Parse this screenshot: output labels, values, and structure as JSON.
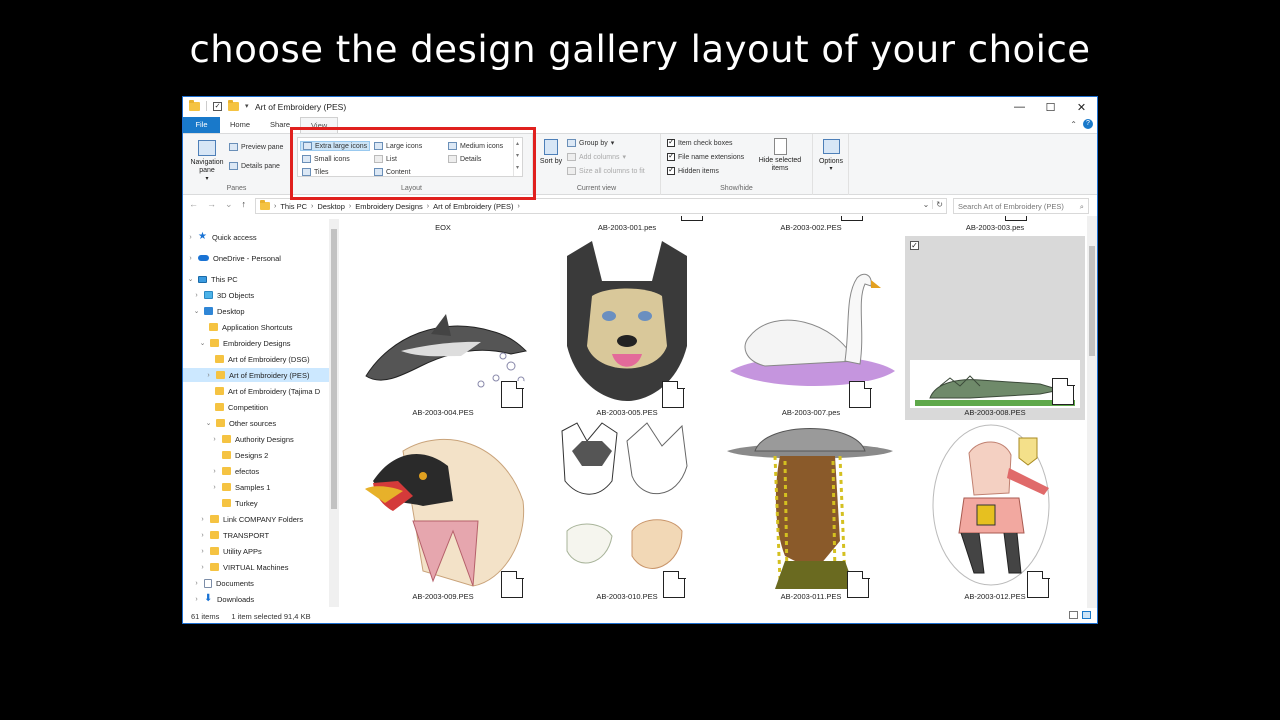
{
  "caption": "choose the design gallery layout of your choice",
  "window": {
    "title": "Art of Embroidery (PES)",
    "controls": {
      "minimize": "—",
      "maximize": "☐",
      "close": "✕"
    }
  },
  "ribbon": {
    "tabs": [
      "File",
      "Home",
      "Share",
      "View"
    ],
    "active_tab": "View",
    "collapse_glyph": "⌃",
    "help_glyph": "?",
    "panes": {
      "navigation_pane": "Navigation pane",
      "preview_pane": "Preview pane",
      "details_pane": "Details pane",
      "label": "Panes"
    },
    "layout": {
      "items": [
        "Extra large icons",
        "Large icons",
        "Medium icons",
        "Small icons",
        "List",
        "Details",
        "Tiles",
        "Content"
      ],
      "selected": "Extra large icons",
      "label": "Layout"
    },
    "current_view": {
      "sort_by": "Sort by",
      "group_by": "Group by",
      "add_columns": "Add columns",
      "size_all_columns": "Size all columns to fit",
      "label": "Current view"
    },
    "show_hide": {
      "item_check_boxes": "Item check boxes",
      "file_name_extensions": "File name extensions",
      "hidden_items": "Hidden items",
      "hide_selected_items": "Hide selected items",
      "label": "Show/hide"
    },
    "options": "Options"
  },
  "address": {
    "back": "←",
    "forward": "→",
    "recent": "⌄",
    "up": "↑",
    "crumbs": [
      "This PC",
      "Desktop",
      "Embroidery Designs",
      "Art of Embroidery (PES)"
    ],
    "separator": "›",
    "dropdown": "⌄",
    "refresh": "↻",
    "search_placeholder": "Search Art of Embroidery (PES)",
    "search_icon": "⌕"
  },
  "nav": {
    "quick_access": "Quick access",
    "onedrive": "OneDrive - Personal",
    "this_pc": "This PC",
    "objects3d": "3D Objects",
    "desktop": "Desktop",
    "app_shortcuts": "Application Shortcuts",
    "embroidery_designs": "Embroidery Designs",
    "aoe_dsg": "Art of Embroidery (DSG)",
    "aoe_pes": "Art of Embroidery (PES)",
    "aoe_tajima": "Art of Embroidery (Tajima D",
    "competition": "Competition",
    "other_sources": "Other sources",
    "authority_designs": "Authority Designs",
    "designs2": "Designs 2",
    "efectos": "efectos",
    "samples1": "Samples 1",
    "turkey": "Turkey",
    "link_company": "Link COMPANY Folders",
    "transport": "TRANSPORT",
    "utility_apps": "Utility APPs",
    "virtual_machines": "VIRTUAL Machines",
    "documents": "Documents",
    "downloads": "Downloads"
  },
  "files": {
    "top_row": [
      "EOX",
      "AB-2003-001.pes",
      "AB-2003-002.PES",
      "AB-2003-003.pes"
    ],
    "row1": [
      "AB-2003-004.PES",
      "AB-2003-005.PES",
      "AB-2003-007.pes",
      "AB-2003-008.PES"
    ],
    "row2": [
      "AB-2003-009.PES",
      "AB-2003-010.PES",
      "AB-2003-011.PES",
      "AB-2003-012.PES"
    ],
    "selected": "AB-2003-008.PES"
  },
  "status": {
    "item_count": "61 items",
    "selection": "1 item selected  91,4 KB"
  },
  "colors": {
    "accent": "#1979ca",
    "highlight_box": "#e0201e",
    "selection": "#d9d9d9"
  }
}
